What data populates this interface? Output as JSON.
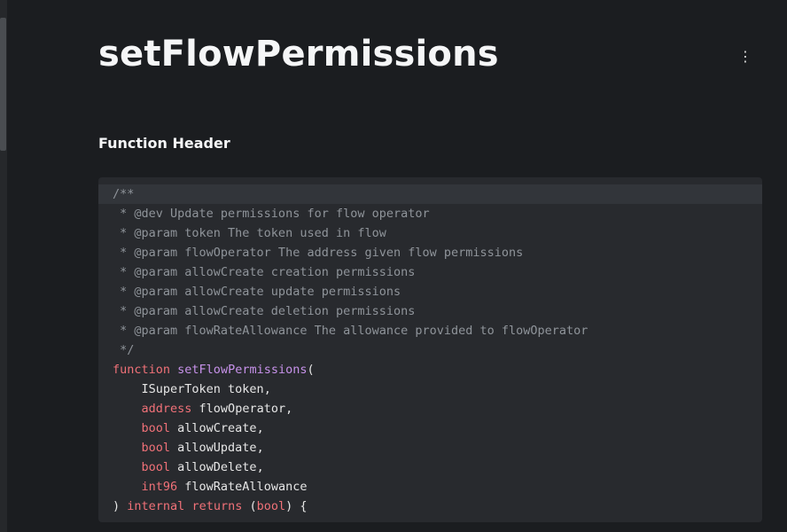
{
  "page": {
    "title": "setFlowPermissions",
    "section_heading": "Function Header",
    "menu_icon": "kebab-menu-icon"
  },
  "code": {
    "comment_lines": [
      "/**",
      " * @dev Update permissions for flow operator",
      " * @param token The token used in flow",
      " * @param flowOperator The address given flow permissions",
      " * @param allowCreate creation permissions",
      " * @param allowCreate update permissions",
      " * @param allowCreate deletion permissions",
      " * @param flowRateAllowance The allowance provided to flowOperator",
      " */"
    ],
    "signature": {
      "keyword": "function",
      "name": "setFlowPermissions",
      "open": "("
    },
    "params": [
      {
        "indent": "    ",
        "type": "ISuperToken",
        "name": " token,",
        "type_is_keyword": false
      },
      {
        "indent": "    ",
        "type": "address",
        "name": " flowOperator,",
        "type_is_keyword": true
      },
      {
        "indent": "    ",
        "type": "bool",
        "name": " allowCreate,",
        "type_is_keyword": true
      },
      {
        "indent": "    ",
        "type": "bool",
        "name": " allowUpdate,",
        "type_is_keyword": true
      },
      {
        "indent": "    ",
        "type": "bool",
        "name": " allowDelete,",
        "type_is_keyword": true
      },
      {
        "indent": "    ",
        "type": "int96",
        "name": " flowRateAllowance",
        "type_is_keyword": true
      }
    ],
    "closing": {
      "paren": ") ",
      "visibility": "internal",
      "returns": "returns",
      "ret_open": "(",
      "ret_type": "bool",
      "ret_close": ") {"
    }
  },
  "colors": {
    "background": "#1b1d20",
    "code_background": "#282a2e",
    "comment": "#8f949a",
    "keyword": "#f07178",
    "function_name": "#c792ea",
    "text": "#e6e6e6"
  }
}
